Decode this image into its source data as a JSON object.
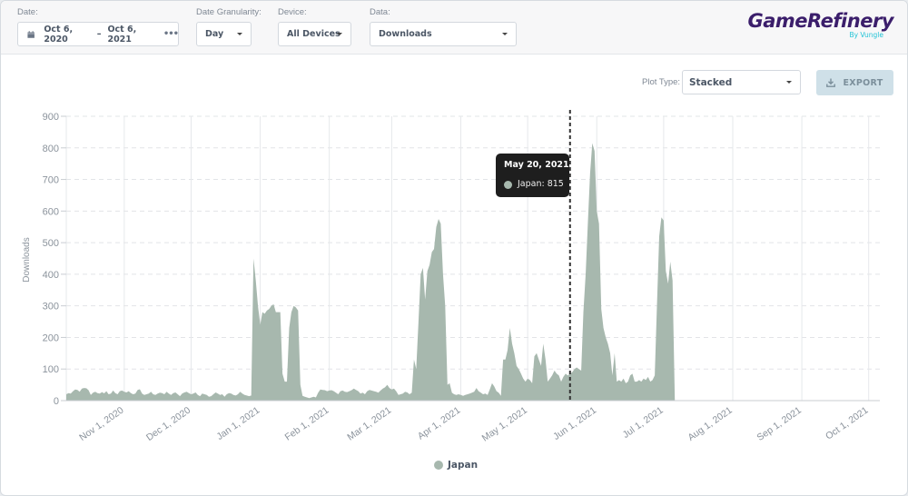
{
  "header": {
    "date": {
      "label": "Date:",
      "start": "Oct 6, 2020",
      "separator": "–",
      "end": "Oct 6, 2021",
      "icon": "calendar-icon",
      "more_icon": "more-dots-icon"
    },
    "granularity": {
      "label": "Date Granularity:",
      "value": "Day"
    },
    "device": {
      "label": "Device:",
      "value": "All Devices"
    },
    "data": {
      "label": "Data:",
      "value": "Downloads"
    },
    "logo": {
      "name": "GameRefinery",
      "sub": "By Vungle"
    }
  },
  "controls": {
    "plot_type_label": "Plot Type:",
    "plot_type_value": "Stacked",
    "export_label": "EXPORT",
    "export_icon": "download-icon"
  },
  "tooltip": {
    "date": "May 20, 2021",
    "series": "Japan",
    "value": 815,
    "text": "Japan: 815"
  },
  "colors": {
    "series": "#a7b8ae",
    "tooltip_bg": "#1e1e1e",
    "brand": "#3b1e6b",
    "brand_sub": "#22c3d6"
  },
  "chart_data": {
    "type": "area",
    "title": "",
    "xlabel": "",
    "ylabel": "Downloads",
    "ylim": [
      0,
      900
    ],
    "yticks": [
      0,
      100,
      200,
      300,
      400,
      500,
      600,
      700,
      800,
      900
    ],
    "x_start": "2020-10-06",
    "x_end": "2021-10-06",
    "xticks": [
      "Nov 1, 2020",
      "Dec 1, 2020",
      "Jan 1, 2021",
      "Feb 1, 2021",
      "Mar 1, 2021",
      "Apr 1, 2021",
      "May 1, 2021",
      "Jun 1, 2021",
      "Jul 1, 2021",
      "Aug 1, 2021",
      "Sep 1, 2021",
      "Oct 1, 2021"
    ],
    "xtick_dates": [
      "2020-11-01",
      "2020-12-01",
      "2021-01-01",
      "2021-02-01",
      "2021-03-01",
      "2021-04-01",
      "2021-05-01",
      "2021-06-01",
      "2021-07-01",
      "2021-08-01",
      "2021-09-01",
      "2021-10-01"
    ],
    "grid": true,
    "legend": "bottom-center",
    "hover_date": "2021-05-20",
    "series": [
      {
        "name": "Japan",
        "start_date": "2020-10-06",
        "values": [
          20,
          24,
          22,
          30,
          35,
          34,
          28,
          38,
          40,
          39,
          33,
          18,
          25,
          28,
          24,
          22,
          27,
          23,
          30,
          20,
          22,
          32,
          24,
          20,
          30,
          32,
          28,
          26,
          30,
          24,
          20,
          22,
          34,
          36,
          22,
          18,
          20,
          22,
          28,
          20,
          18,
          22,
          25,
          24,
          20,
          28,
          22,
          18,
          24,
          26,
          20,
          14,
          22,
          26,
          28,
          24,
          20,
          22,
          26,
          18,
          14,
          22,
          20,
          18,
          12,
          14,
          20,
          26,
          22,
          18,
          20,
          12,
          20,
          24,
          22,
          18,
          16,
          20,
          28,
          22,
          18,
          16,
          14,
          16,
          450,
          380,
          300,
          240,
          280,
          275,
          285,
          290,
          300,
          305,
          280,
          280,
          280,
          85,
          60,
          60,
          230,
          280,
          300,
          295,
          285,
          50,
          15,
          12,
          10,
          8,
          10,
          12,
          10,
          25,
          35,
          34,
          33,
          30,
          32,
          33,
          30,
          25,
          20,
          30,
          32,
          28,
          27,
          30,
          33,
          38,
          34,
          30,
          22,
          25,
          20,
          30,
          34,
          32,
          30,
          28,
          25,
          32,
          38,
          42,
          50,
          40,
          35,
          38,
          30,
          18,
          20,
          22,
          28,
          26,
          20,
          25,
          130,
          100,
          250,
          400,
          420,
          320,
          410,
          430,
          470,
          480,
          550,
          575,
          560,
          400,
          300,
          50,
          55,
          25,
          20,
          18,
          20,
          18,
          15,
          18,
          20,
          22,
          25,
          28,
          40,
          30,
          25,
          20,
          22,
          18,
          35,
          55,
          45,
          30,
          25,
          15,
          130,
          130,
          160,
          230,
          180,
          150,
          110,
          100,
          85,
          70,
          60,
          70,
          65,
          55,
          140,
          150,
          130,
          110,
          180,
          130,
          60,
          70,
          80,
          95,
          85,
          80,
          60,
          75,
          85,
          80,
          85,
          90,
          100,
          105,
          100,
          95,
          280,
          400,
          560,
          720,
          815,
          790,
          600,
          560,
          290,
          230,
          200,
          180,
          150,
          80,
          150,
          60,
          65,
          60,
          70,
          55,
          60,
          80,
          85,
          60,
          60,
          65,
          60,
          70,
          65,
          75,
          60,
          65,
          80,
          300,
          520,
          580,
          570,
          410,
          370,
          440,
          380,
          0
        ]
      }
    ]
  }
}
